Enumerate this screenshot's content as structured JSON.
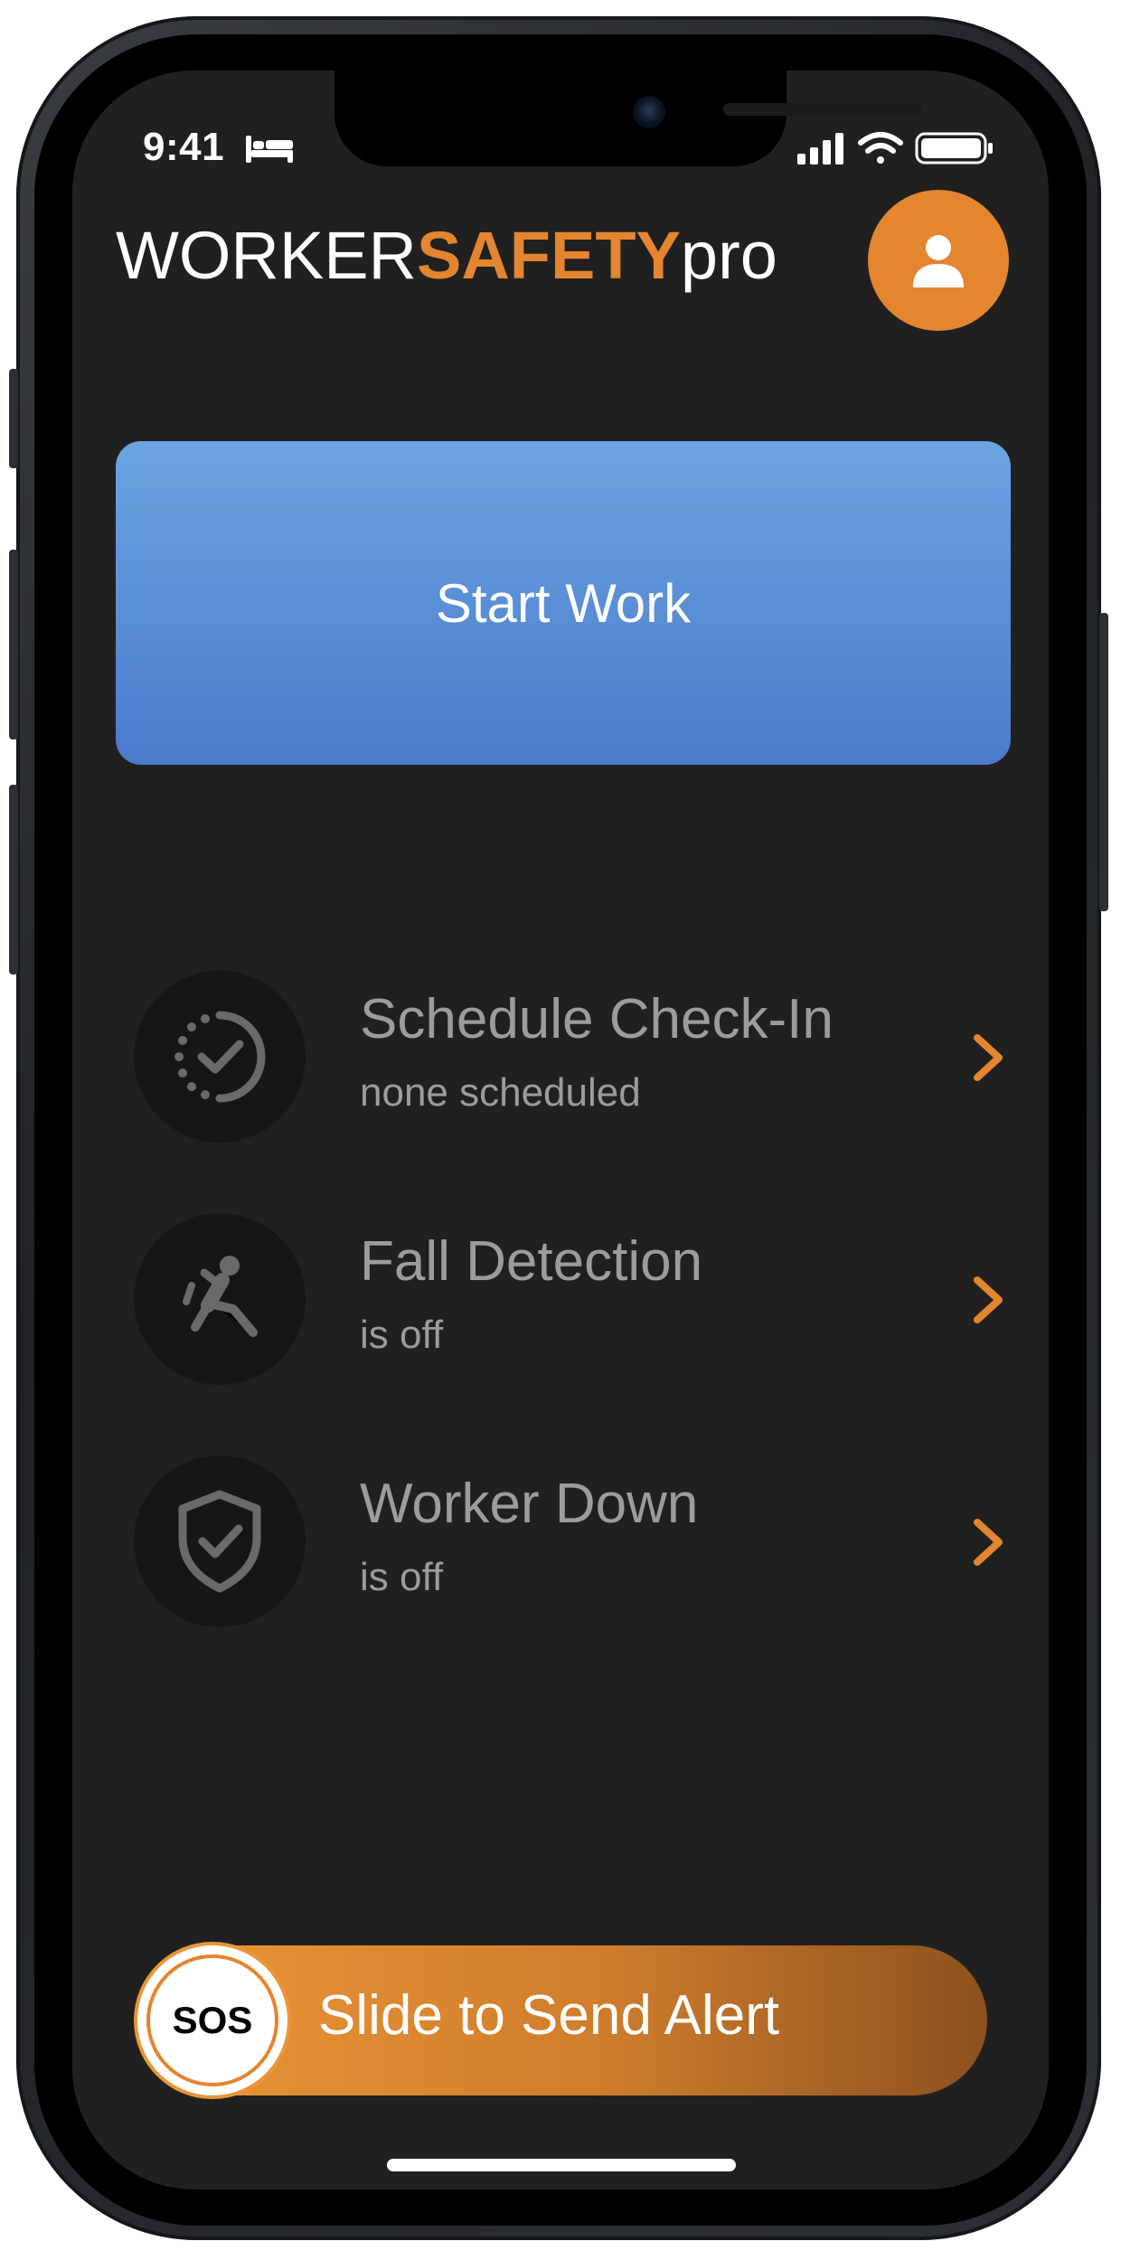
{
  "status_bar": {
    "time": "9:41"
  },
  "header": {
    "logo_part1": "WORKER",
    "logo_part2": "SAFETY",
    "logo_part3": "pro"
  },
  "start_button": {
    "label": "Start Work"
  },
  "features": [
    {
      "title": "Schedule Check-In",
      "subtitle": "none scheduled",
      "icon": "scheduled-check-icon"
    },
    {
      "title": "Fall Detection",
      "subtitle": "is off",
      "icon": "falling-person-icon"
    },
    {
      "title": "Worker Down",
      "subtitle": "is off",
      "icon": "shield-check-icon"
    }
  ],
  "sos_slider": {
    "knob_label": "SOS",
    "label": "Slide to Send Alert"
  },
  "colors": {
    "accent": "#e4852f",
    "start_button_top": "#6aa5e1",
    "start_button_bottom": "#4b7acb",
    "background": "#202020",
    "muted_text": "#9c9c9c"
  }
}
